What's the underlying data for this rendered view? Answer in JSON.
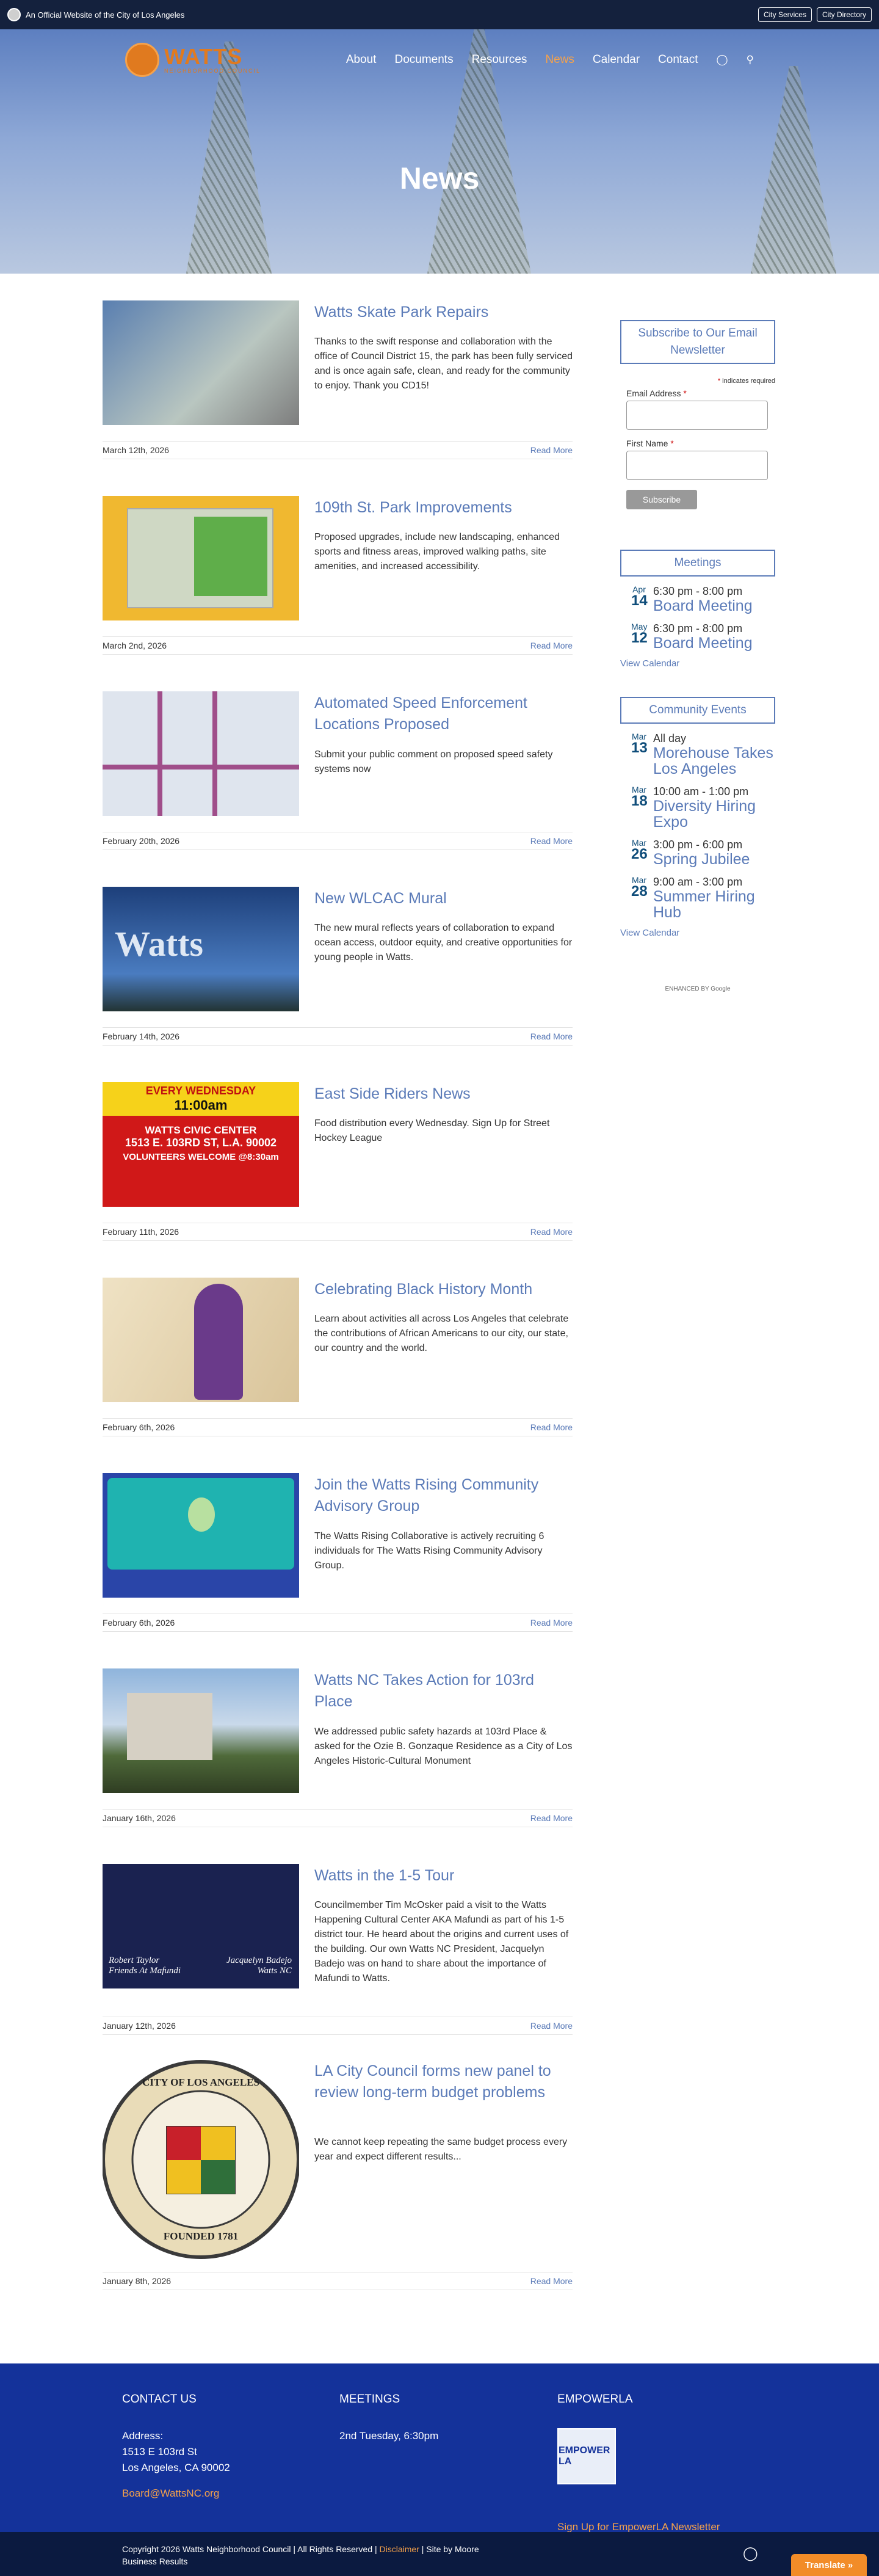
{
  "topbar": {
    "official_text": "An Official Website of the City of Los Angeles",
    "city_services": "City Services",
    "city_directory": "City Directory"
  },
  "logo": {
    "name": "WATTS",
    "tagline": "NEIGHBORHOOD COUNCIL"
  },
  "nav": {
    "items": [
      "About",
      "Documents",
      "Resources",
      "News",
      "Calendar",
      "Contact"
    ],
    "active": "News",
    "icons": [
      "instagram-icon",
      "search-icon"
    ]
  },
  "hero": {
    "title": "News"
  },
  "posts": [
    {
      "title": "Watts Skate Park Repairs",
      "excerpt": "Thanks to the swift response and collaboration with the office of Council District 15, the park has been fully serviced and is once again safe, clean, and ready for the community to enjoy. Thank you CD15!",
      "date": "March 12th, 2026",
      "more": "Read More"
    },
    {
      "title": "109th St. Park Improvements",
      "excerpt": "Proposed upgrades, include new landscaping, enhanced sports and fitness areas, improved walking paths, site amenities, and increased accessibility.",
      "date": "March 2nd, 2026",
      "more": "Read More"
    },
    {
      "title": "Automated Speed Enforcement Locations Proposed",
      "excerpt": "Submit your public comment on proposed speed safety systems now",
      "date": "February 20th, 2026",
      "more": "Read More"
    },
    {
      "title": "New WLCAC Mural",
      "excerpt": "The new mural reflects years of collaboration to expand ocean access, outdoor equity, and creative opportunities for young people in Watts.",
      "date": "February 14th, 2026",
      "more": "Read More"
    },
    {
      "title": "East Side Riders News",
      "excerpt": "Food distribution every Wednesday. Sign Up for Street Hockey League",
      "date": "February 11th, 2026",
      "more": "Read More"
    },
    {
      "title": "Celebrating Black History Month",
      "excerpt": "Learn about activities all across Los Angeles that celebrate the contributions of African Americans to our city, our state, our country and the world.",
      "date": "February 6th, 2026",
      "more": "Read More"
    },
    {
      "title": "Join the Watts Rising Community Advisory Group",
      "excerpt": "The Watts Rising Collaborative is actively recruiting 6 individuals for The Watts Rising Community Advisory Group.",
      "date": "February 6th, 2026",
      "more": "Read More"
    },
    {
      "title": "Watts NC Takes Action for 103rd Place",
      "excerpt": "We addressed public safety hazards at 103rd Place & asked for the Ozie B. Gonzaque Residence as a City of Los Angeles Historic-Cultural Monument",
      "date": "January 16th, 2026",
      "more": "Read More"
    },
    {
      "title": "Watts in the 1-5 Tour",
      "excerpt": "Councilmember Tim McOsker paid a visit to the Watts Happening Cultural Center AKA Mafundi as part of his 1-5 district tour. He heard about the origins and current uses of the building. Our own Watts NC President, Jacquelyn Badejo was on hand to share about the importance of Mafundi to Watts.",
      "date": "January 12th, 2026",
      "more": "Read More"
    },
    {
      "title": "LA City Council forms new panel to review long-term budget problems",
      "excerpt": "We cannot keep repeating the same budget process every year and expect different results...",
      "date": "January 8th, 2026",
      "more": "Read More"
    }
  ],
  "thumb_text": {
    "riders": {
      "day": "EVERY WEDNESDAY",
      "time": "11:00am",
      "place": "WATTS CIVIC CENTER",
      "addr": "1513 E. 103RD ST, L.A. 90002",
      "vol": "VOLUNTEERS WELCOME @8:30am"
    },
    "mural": {
      "word": "Watts"
    },
    "tour": {
      "left": "Robert Taylor Friends At Mafundi",
      "right": "Jacquelyn Badejo Watts NC"
    },
    "seal": {
      "top": "CITY OF LOS ANGELES",
      "bottom": "FOUNDED 1781"
    }
  },
  "sidebar": {
    "newsletter": {
      "title": "Subscribe to Our Email Newsletter",
      "required_note": "indicates required",
      "email_label": "Email Address",
      "first_name_label": "First Name",
      "button": "Subscribe"
    },
    "meetings": {
      "title": "Meetings",
      "events": [
        {
          "month": "Apr",
          "day": "14",
          "time": "6:30 pm - 8:00 pm",
          "name": "Board Meeting"
        },
        {
          "month": "May",
          "day": "12",
          "time": "6:30 pm - 8:00 pm",
          "name": "Board Meeting"
        }
      ],
      "view": "View Calendar"
    },
    "community": {
      "title": "Community Events",
      "events": [
        {
          "month": "Mar",
          "day": "13",
          "time": "All day",
          "name": "Morehouse Takes Los Angeles"
        },
        {
          "month": "Mar",
          "day": "18",
          "time": "10:00 am - 1:00 pm",
          "name": "Diversity Hiring Expo"
        },
        {
          "month": "Mar",
          "day": "26",
          "time": "3:00 pm - 6:00 pm",
          "name": "Spring Jubilee"
        },
        {
          "month": "Mar",
          "day": "28",
          "time": "9:00 am - 3:00 pm",
          "name": "Summer Hiring Hub"
        }
      ],
      "view": "View Calendar"
    },
    "google": "ENHANCED BY Google"
  },
  "footer": {
    "contact_title": "CONTACT US",
    "address_label": "Address:",
    "address1": "1513 E 103rd St",
    "address2": "Los Angeles, CA 90002",
    "email": "Board@WattsNC.org",
    "meetings_title": "MEETINGS",
    "meetings_text": "2nd Tuesday, 6:30pm",
    "empower_title": "EMPOWERLA",
    "empower_logo": "EMPOWER LA",
    "empower_link": "Sign Up for EmpowerLA Newsletter"
  },
  "bottom": {
    "copyright": "Copyright 2026 Watts Neighborhood Council | All Rights Reserved |",
    "disclaimer": "Disclaimer",
    "site_by": "| Site by",
    "designer": "Moore Business Results",
    "translate": "Translate »"
  },
  "colors": {
    "navy": "#14213d",
    "footer_blue": "#14329a",
    "link_blue": "#5b7bb8",
    "orange": "#f28c28"
  }
}
